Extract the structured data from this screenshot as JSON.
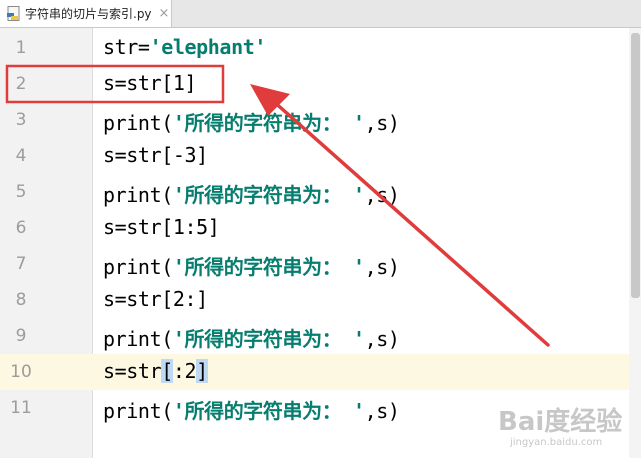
{
  "tab": {
    "file_name": "字符串的切片与索引.py",
    "close_glyph": "×",
    "icon": "python-file-icon"
  },
  "editor": {
    "current_line": 10,
    "lines": [
      {
        "num": "1",
        "parts": [
          {
            "t": "str=",
            "c": "plain"
          },
          {
            "t": "'elephant'",
            "c": "str"
          }
        ]
      },
      {
        "num": "2",
        "parts": [
          {
            "t": "s=str[1]",
            "c": "plain"
          }
        ]
      },
      {
        "num": "3",
        "parts": [
          {
            "t": "print(",
            "c": "plain"
          },
          {
            "t": "'所得的字符串为： '",
            "c": "str"
          },
          {
            "t": ",s)",
            "c": "plain"
          }
        ]
      },
      {
        "num": "4",
        "parts": [
          {
            "t": "s=str[-3]",
            "c": "plain"
          }
        ]
      },
      {
        "num": "5",
        "parts": [
          {
            "t": "print(",
            "c": "plain"
          },
          {
            "t": "'所得的字符串为： '",
            "c": "str"
          },
          {
            "t": ",s)",
            "c": "plain"
          }
        ]
      },
      {
        "num": "6",
        "parts": [
          {
            "t": "s=str[1:5]",
            "c": "plain"
          }
        ]
      },
      {
        "num": "7",
        "parts": [
          {
            "t": "print(",
            "c": "plain"
          },
          {
            "t": "'所得的字符串为： '",
            "c": "str"
          },
          {
            "t": ",s)",
            "c": "plain"
          }
        ]
      },
      {
        "num": "8",
        "parts": [
          {
            "t": "s=str[2:]",
            "c": "plain"
          }
        ]
      },
      {
        "num": "9",
        "parts": [
          {
            "t": "print(",
            "c": "plain"
          },
          {
            "t": "'所得的字符串为： '",
            "c": "str"
          },
          {
            "t": ",s)",
            "c": "plain"
          }
        ]
      },
      {
        "num": "10",
        "parts": [
          {
            "t": "s=str",
            "c": "plain"
          },
          {
            "t": "[",
            "c": "sel"
          },
          {
            "t": ":2",
            "c": "plain"
          },
          {
            "t": "]",
            "c": "sel"
          }
        ]
      },
      {
        "num": "11",
        "parts": [
          {
            "t": "print(",
            "c": "plain"
          },
          {
            "t": "'所得的字符串为： '",
            "c": "str"
          },
          {
            "t": ",s)",
            "c": "plain"
          }
        ]
      }
    ]
  },
  "colors": {
    "string": "#067d6e",
    "annotation": "#e03c3c",
    "current_line": "#fdf8e1",
    "bracket_match": "#bfd9f5"
  },
  "watermark": {
    "text": "Bai度经验",
    "url": "jingyan.baidu.com"
  }
}
